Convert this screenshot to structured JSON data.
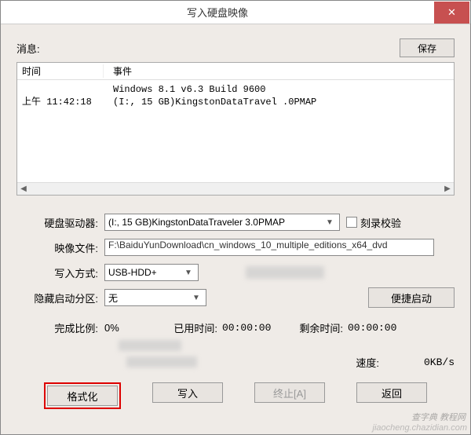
{
  "titlebar": {
    "title": "写入硬盘映像",
    "close": "✕"
  },
  "top": {
    "message_label": "消息:",
    "save_label": "保存"
  },
  "log": {
    "col_time": "时间",
    "col_event": "事件",
    "rows": [
      {
        "time": "",
        "event": "Windows 8.1 v6.3 Build 9600"
      },
      {
        "time": "上午 11:42:18",
        "event": "(I:, 15 GB)KingstonDataTravel   .0PMAP"
      }
    ]
  },
  "form": {
    "drive_label": "硬盘驱动器:",
    "drive_value": "(I:, 15 GB)KingstonDataTraveler 3.0PMAP",
    "verify_label": "刻录校验",
    "image_label": "映像文件:",
    "image_value": "F:\\BaiduYunDownload\\cn_windows_10_multiple_editions_x64_dvd",
    "write_method_label": "写入方式:",
    "write_method_value": "USB-HDD+",
    "hide_boot_label": "隐藏启动分区:",
    "hide_boot_value": "无",
    "quick_boot_label": "便捷启动"
  },
  "status": {
    "percent_label": "完成比例:",
    "percent_value": "0%",
    "elapsed_label": "已用时间:",
    "elapsed_value": "00:00:00",
    "remaining_label": "剩余时间:",
    "remaining_value": "00:00:00",
    "speed_label": "速度:",
    "speed_value": "0KB/s"
  },
  "buttons": {
    "format": "格式化",
    "write": "写入",
    "abort": "终止[A]",
    "back": "返回"
  },
  "watermark": "jiaocheng.chazidian.com",
  "watermark2": "查字典  教程网"
}
